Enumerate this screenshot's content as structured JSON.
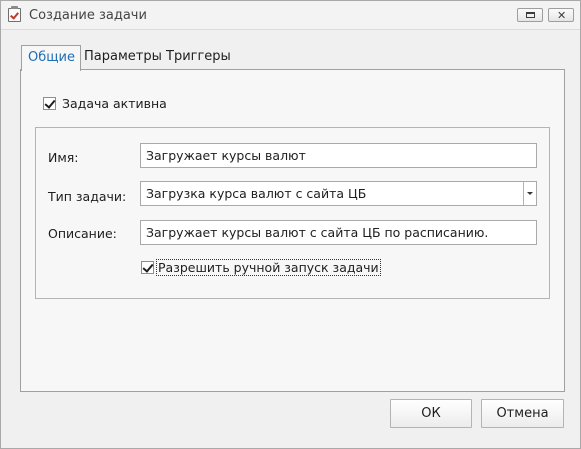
{
  "window": {
    "title": "Создание задачи",
    "icon": "task-calendar-icon"
  },
  "tabs": [
    {
      "label": "Общие",
      "active": true
    },
    {
      "label": "Параметры",
      "active": false
    },
    {
      "label": "Триггеры",
      "active": false
    }
  ],
  "general": {
    "task_active": {
      "label": "Задача активна",
      "checked": true
    },
    "name": {
      "label": "Имя:",
      "value": "Загружает курсы валют"
    },
    "task_type": {
      "label": "Тип задачи:",
      "value": "Загрузка курса валют с сайта ЦБ"
    },
    "description": {
      "label": "Описание:",
      "value": "Загружает курсы валют с сайта ЦБ по расписанию."
    },
    "allow_manual": {
      "label": "Разрешить ручной запуск задачи",
      "checked": true
    }
  },
  "buttons": {
    "ok": "ОК",
    "cancel": "Отмена"
  }
}
